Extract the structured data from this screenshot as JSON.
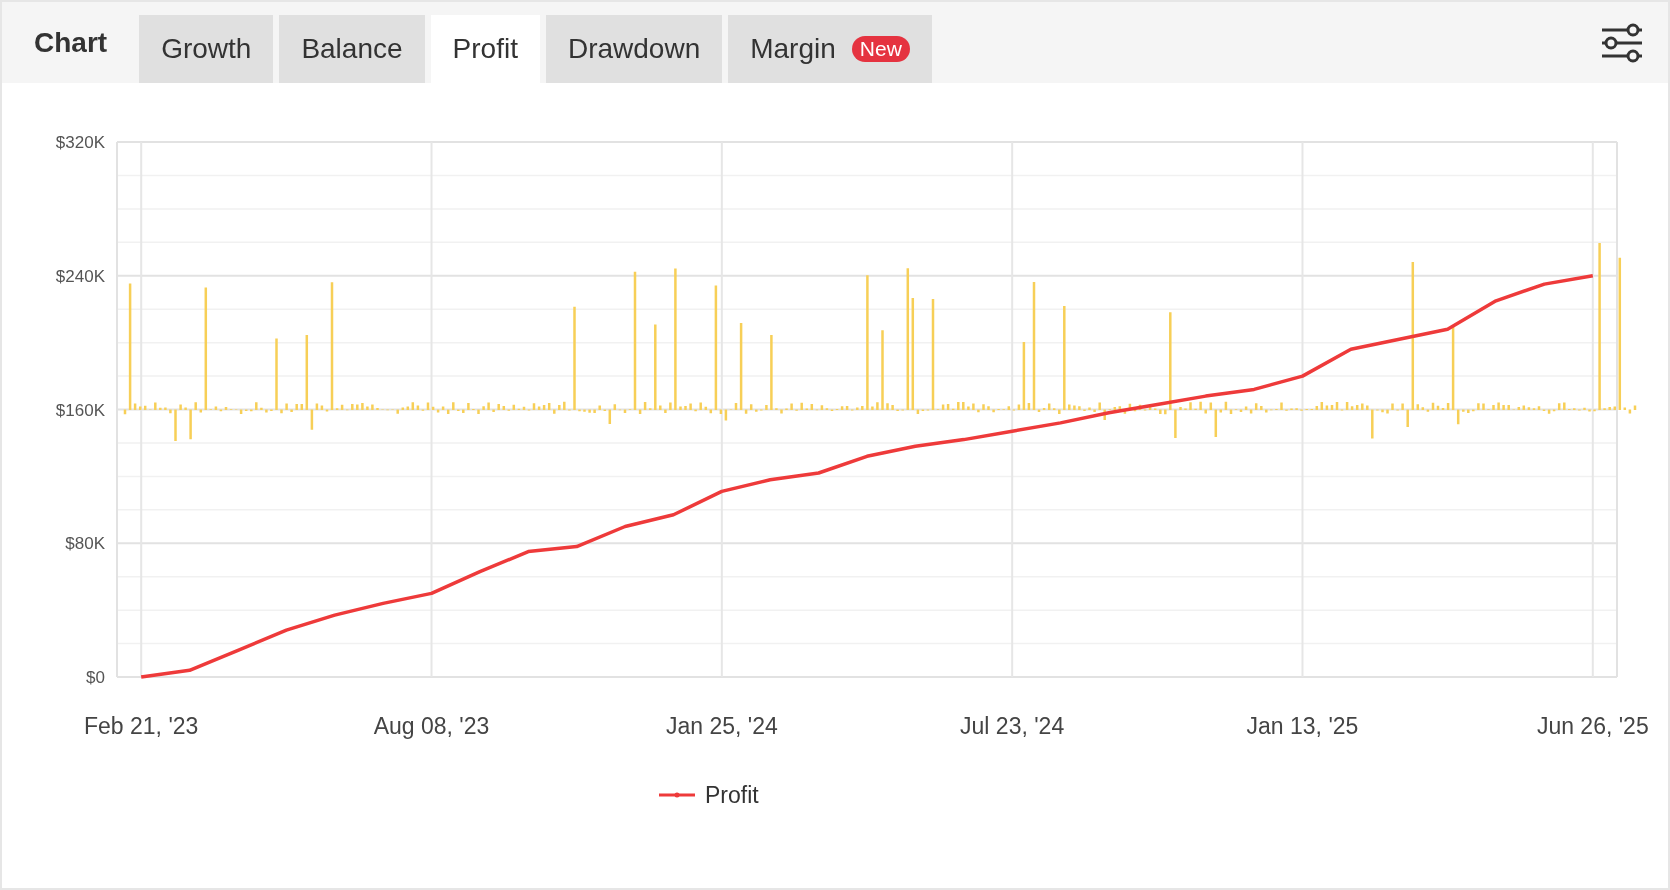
{
  "header": {
    "title": "Chart"
  },
  "tabs": [
    {
      "label": "Growth",
      "selected": false
    },
    {
      "label": "Balance",
      "selected": false
    },
    {
      "label": "Profit",
      "selected": true
    },
    {
      "label": "Drawdown",
      "selected": false
    },
    {
      "label": "Margin",
      "selected": false,
      "badge": "New"
    }
  ],
  "chart_data": {
    "type": "line",
    "categories": [
      "Feb 21, '23",
      null,
      null,
      null,
      null,
      null,
      "Aug 08, '23",
      null,
      null,
      null,
      null,
      null,
      "Jan 25, '24",
      null,
      null,
      null,
      null,
      null,
      "Jul 23, '24",
      null,
      null,
      null,
      null,
      null,
      "Jan 13, '25",
      null,
      null,
      null,
      null,
      null,
      "Jun 26, '25"
    ],
    "grid": true,
    "ylim": [
      0,
      320000
    ],
    "yticks": [
      {
        "value": 0,
        "label": "$0"
      },
      {
        "value": 80000,
        "label": "$80K"
      },
      {
        "value": 160000,
        "label": "$160K"
      },
      {
        "value": 240000,
        "label": "$240K"
      },
      {
        "value": 320000,
        "label": "$320K"
      }
    ],
    "series": [
      {
        "name": "Profit",
        "color": "#ee3a3a",
        "values": [
          0,
          4000,
          16000,
          28000,
          37000,
          44000,
          50000,
          63000,
          75000,
          78000,
          90000,
          97000,
          111000,
          118000,
          122000,
          132000,
          138000,
          142000,
          147000,
          152000,
          158000,
          163000,
          168000,
          172000,
          180000,
          196000,
          202000,
          208000,
          225000,
          235000,
          240000
        ]
      }
    ]
  }
}
